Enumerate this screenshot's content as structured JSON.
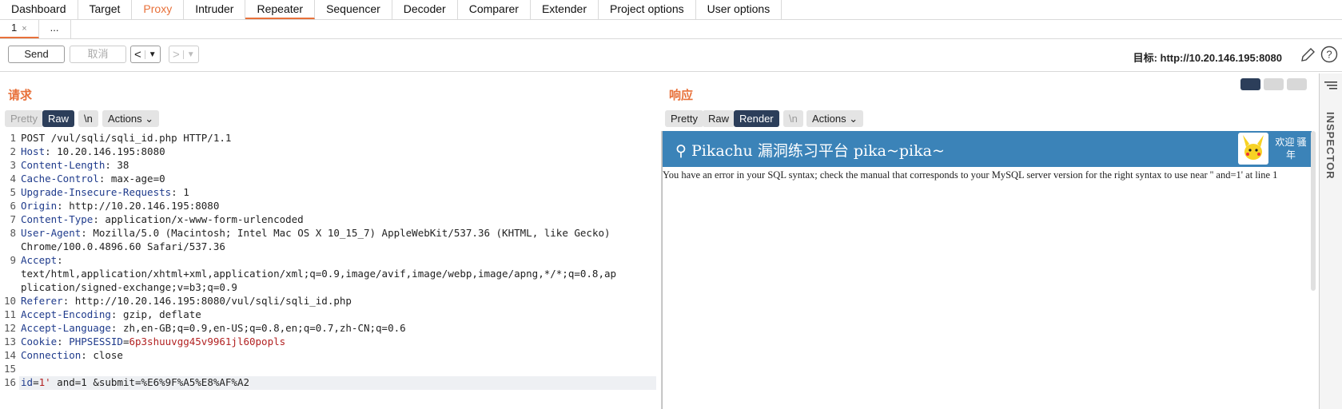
{
  "topnav": {
    "tabs": [
      "Dashboard",
      "Target",
      "Proxy",
      "Intruder",
      "Repeater",
      "Sequencer",
      "Decoder",
      "Comparer",
      "Extender",
      "Project options",
      "User options"
    ]
  },
  "subtabs": {
    "first": "1",
    "more": "..."
  },
  "toolbar": {
    "send": "Send",
    "cancel": "取消",
    "target_label": "目标: http://10.20.146.195:8080"
  },
  "request": {
    "title": "请求",
    "modes": [
      "Pretty",
      "Raw",
      "\\n",
      "Actions"
    ],
    "lines": [
      {
        "n": "1",
        "k": "",
        "v": "POST /vul/sqli/sqli_id.php HTTP/1.1"
      },
      {
        "n": "2",
        "k": "Host",
        "v": ": 10.20.146.195:8080"
      },
      {
        "n": "3",
        "k": "Content-Length",
        "v": ": 38"
      },
      {
        "n": "4",
        "k": "Cache-Control",
        "v": ": max-age=0"
      },
      {
        "n": "5",
        "k": "Upgrade-Insecure-Requests",
        "v": ": 1"
      },
      {
        "n": "6",
        "k": "Origin",
        "v": ": http://10.20.146.195:8080"
      },
      {
        "n": "7",
        "k": "Content-Type",
        "v": ": application/x-www-form-urlencoded"
      },
      {
        "n": "8",
        "k": "User-Agent",
        "v": ": Mozilla/5.0 (Macintosh; Intel Mac OS X 10_15_7) AppleWebKit/537.36 (KHTML, like Gecko)"
      },
      {
        "n": "",
        "k": "",
        "v": "Chrome/100.0.4896.60 Safari/537.36"
      },
      {
        "n": "9",
        "k": "Accept",
        "v": ":"
      },
      {
        "n": "",
        "k": "",
        "v": "text/html,application/xhtml+xml,application/xml;q=0.9,image/avif,image/webp,image/apng,*/*;q=0.8,ap"
      },
      {
        "n": "",
        "k": "",
        "v": "plication/signed-exchange;v=b3;q=0.9"
      },
      {
        "n": "10",
        "k": "Referer",
        "v": ": http://10.20.146.195:8080/vul/sqli/sqli_id.php"
      },
      {
        "n": "11",
        "k": "Accept-Encoding",
        "v": ": gzip, deflate"
      },
      {
        "n": "12",
        "k": "Accept-Language",
        "v": ": zh,en-GB;q=0.9,en-US;q=0.8,en;q=0.7,zh-CN;q=0.6"
      },
      {
        "n": "13",
        "k": "Cookie",
        "v": ": PHPSESSID=6p3shuuvgg45v9961jl60popls"
      },
      {
        "n": "14",
        "k": "Connection",
        "v": ": close"
      },
      {
        "n": "15",
        "k": "",
        "v": ""
      },
      {
        "n": "16",
        "k": "id",
        "v": "=1' and=1 &submit=%E6%9F%A5%E8%AF%A2"
      }
    ]
  },
  "response": {
    "title": "响应",
    "modes": [
      "Pretty",
      "Raw",
      "Render",
      "\\n",
      "Actions"
    ],
    "banner_title": "Pikachu 漏洞练习平台 pika~pika~",
    "welcome": "欢迎 骚年",
    "error": "You have an error in your SQL syntax; check the manual that corresponds to your MySQL server version for the right syntax to use near '' and=1' at line 1"
  },
  "inspector": {
    "label": "INSPECTOR"
  },
  "colors": {
    "accent": "#e8713a",
    "navy": "#2c3e5a",
    "banner": "#3b83b8",
    "header_key": "#1f3b8c"
  }
}
